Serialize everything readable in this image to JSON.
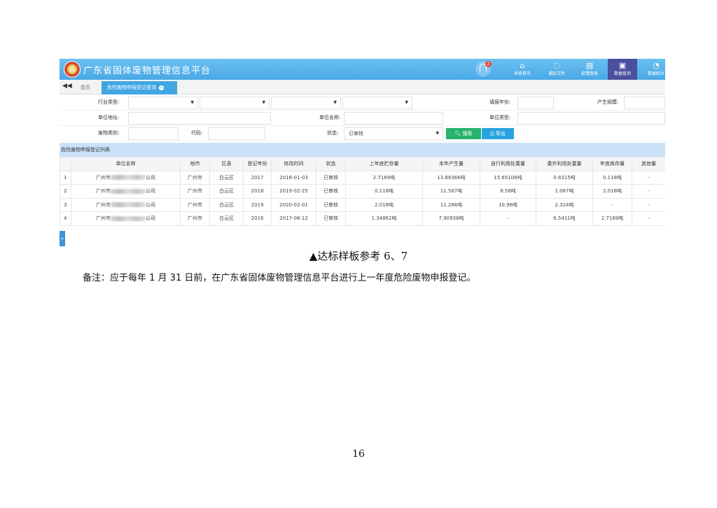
{
  "app": {
    "title": "广东省固体废物管理信息平台"
  },
  "notifications": {
    "badge": "2"
  },
  "nav": [
    {
      "label": "系统首页",
      "glyph": "⌂",
      "icon": "home-icon"
    },
    {
      "label": "通知文件",
      "glyph": "◌",
      "icon": "chat-icon"
    },
    {
      "label": "疫情医废",
      "glyph": "▤",
      "icon": "document-icon"
    },
    {
      "label": "数据查询",
      "glyph": "▣",
      "icon": "data-query-icon",
      "active": true
    },
    {
      "label": "数据统计",
      "glyph": "◔",
      "icon": "pie-chart-icon"
    }
  ],
  "tabs": {
    "back": "◀◀",
    "home": "首页",
    "active": "危险废物申报登记查询",
    "close": "×"
  },
  "filters": {
    "industry_label": "行业类型:",
    "fill_year_label": "填报年份:",
    "scale_label": "产生规模:",
    "address_label": "单位地址:",
    "unit_name_label": "单位名称:",
    "unit_type_label": "单位类型:",
    "waste_type_label": "废物类别:",
    "code_label": "代码:",
    "status_label": "状态:",
    "status_value": "已审核",
    "caret": "▼"
  },
  "buttons": {
    "search": "搜索",
    "export": "导出"
  },
  "list": {
    "title": "危险废物申报登记列表",
    "columns": [
      "",
      "单位名称",
      "地市",
      "区县",
      "登记年份",
      "修改时间",
      "状态",
      "上年底贮存量",
      "本年产生量",
      "自行利用处置量",
      "委外利用处置量",
      "年底库存量",
      "其他量"
    ],
    "rows": [
      {
        "no": "1",
        "name_prefix": "广州市",
        "name_suffix": "公司",
        "city": "广州市",
        "district": "白云区",
        "year": "2017",
        "modified": "2018-01-03",
        "status": "已审核",
        "prev_storage": "2.7169吨",
        "produced": "13.88366吨",
        "self_disposal": "15.65106吨",
        "outsourced": "0.8315吨",
        "year_end": "0.118吨",
        "other": "-"
      },
      {
        "no": "2",
        "name_prefix": "广州市",
        "name_suffix": "公司",
        "city": "广州市",
        "district": "白云区",
        "year": "2018",
        "modified": "2019-02-25",
        "status": "已审核",
        "prev_storage": "0.118吨",
        "produced": "11.567吨",
        "self_disposal": "8.58吨",
        "outsourced": "1.087吨",
        "year_end": "2.018吨",
        "other": "-"
      },
      {
        "no": "3",
        "name_prefix": "广州市",
        "name_suffix": "公司",
        "city": "广州市",
        "district": "白云区",
        "year": "2019",
        "modified": "2020-02-01",
        "status": "已审核",
        "prev_storage": "2.018吨",
        "produced": "11.266吨",
        "self_disposal": "10.96吨",
        "outsourced": "2.324吨",
        "year_end": "-",
        "other": "-"
      },
      {
        "no": "4",
        "name_prefix": "广州市",
        "name_suffix": "公司",
        "city": "广州市",
        "district": "白云区",
        "year": "2016",
        "modified": "2017-06-12",
        "status": "已审核",
        "prev_storage": "1.34862吨",
        "produced": "7.90938吨",
        "self_disposal": "-",
        "outsourced": "6.5411吨",
        "year_end": "2.7169吨",
        "other": "-"
      }
    ]
  },
  "side_toggle": "»",
  "document": {
    "caption": "▲达标样板参考 6、7",
    "note": "备注：应于每年 1 月 31 日前，在广东省固体废物管理信息平台进行上一年度危险废物申报登记。",
    "page_number": "16"
  },
  "colors": {
    "header": "#49a8e6",
    "nav_active": "#4a4f9e",
    "search_button": "#27b36b",
    "export_button": "#28a4e0",
    "section_bar": "#c9e2f7"
  }
}
